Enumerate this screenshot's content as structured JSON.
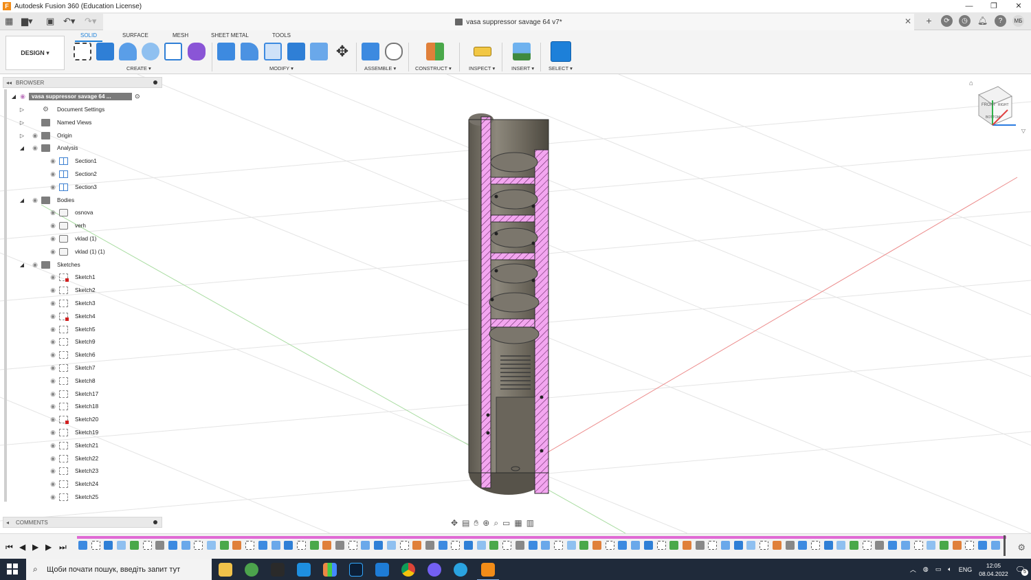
{
  "window": {
    "title": "Autodesk Fusion 360 (Education License)",
    "min": "—",
    "max": "❐",
    "close": "✕"
  },
  "document": {
    "tab_title": "vasa suppressor savage 64 v7*",
    "close": "✕"
  },
  "user": {
    "initials": "МБ"
  },
  "workspace": {
    "label": "DESIGN ▾"
  },
  "ribbon_tabs": [
    "SOLID",
    "SURFACE",
    "MESH",
    "SHEET METAL",
    "TOOLS"
  ],
  "ribbon_groups": {
    "create": "CREATE ▾",
    "modify": "MODIFY ▾",
    "assemble": "ASSEMBLE ▾",
    "construct": "CONSTRUCT ▾",
    "inspect": "INSPECT ▾",
    "insert": "INSERT ▾",
    "select": "SELECT ▾"
  },
  "browser": {
    "title": "BROWSER",
    "root": "vasa suppressor savage 64 ...",
    "items": [
      {
        "label": "Document Settings",
        "icon": "gear",
        "level": 1,
        "twisty": "▷",
        "eye": false
      },
      {
        "label": "Named Views",
        "icon": "folder",
        "level": 1,
        "twisty": "▷",
        "eye": false
      },
      {
        "label": "Origin",
        "icon": "folder",
        "level": 1,
        "twisty": "▷",
        "eye": true
      },
      {
        "label": "Analysis",
        "icon": "folder",
        "level": 1,
        "twisty": "◢",
        "eye": true
      },
      {
        "label": "Section1",
        "icon": "section",
        "level": 2,
        "eye": true
      },
      {
        "label": "Section2",
        "icon": "section",
        "level": 2,
        "eye": true
      },
      {
        "label": "Section3",
        "icon": "section",
        "level": 2,
        "eye": true
      },
      {
        "label": "Bodies",
        "icon": "folder",
        "level": 1,
        "twisty": "◢",
        "eye": true
      },
      {
        "label": "osnova",
        "icon": "body",
        "level": 2,
        "eye": true
      },
      {
        "label": "verh",
        "icon": "body",
        "level": 2,
        "eye": true
      },
      {
        "label": "vklad (1)",
        "icon": "body",
        "level": 2,
        "eye": true
      },
      {
        "label": "vklad (1) (1)",
        "icon": "body",
        "level": 2,
        "eye": true
      },
      {
        "label": "Sketches",
        "icon": "folder",
        "level": 1,
        "twisty": "◢",
        "eye": true
      },
      {
        "label": "Sketch1",
        "icon": "sketch-err",
        "level": 2,
        "eye": true
      },
      {
        "label": "Sketch2",
        "icon": "sketch",
        "level": 2,
        "eye": true
      },
      {
        "label": "Sketch3",
        "icon": "sketch",
        "level": 2,
        "eye": true
      },
      {
        "label": "Sketch4",
        "icon": "sketch-err",
        "level": 2,
        "eye": true
      },
      {
        "label": "Sketch5",
        "icon": "sketch",
        "level": 2,
        "eye": true
      },
      {
        "label": "Sketch9",
        "icon": "sketch",
        "level": 2,
        "eye": true
      },
      {
        "label": "Sketch6",
        "icon": "sketch",
        "level": 2,
        "eye": true
      },
      {
        "label": "Sketch7",
        "icon": "sketch",
        "level": 2,
        "eye": true
      },
      {
        "label": "Sketch8",
        "icon": "sketch",
        "level": 2,
        "eye": true
      },
      {
        "label": "Sketch17",
        "icon": "sketch",
        "level": 2,
        "eye": true
      },
      {
        "label": "Sketch18",
        "icon": "sketch",
        "level": 2,
        "eye": true
      },
      {
        "label": "Sketch20",
        "icon": "sketch-err",
        "level": 2,
        "eye": true
      },
      {
        "label": "Sketch19",
        "icon": "sketch",
        "level": 2,
        "eye": true
      },
      {
        "label": "Sketch21",
        "icon": "sketch",
        "level": 2,
        "eye": true
      },
      {
        "label": "Sketch22",
        "icon": "sketch",
        "level": 2,
        "eye": true
      },
      {
        "label": "Sketch23",
        "icon": "sketch",
        "level": 2,
        "eye": true
      },
      {
        "label": "Sketch24",
        "icon": "sketch",
        "level": 2,
        "eye": true
      },
      {
        "label": "Sketch25",
        "icon": "sketch",
        "level": 2,
        "eye": true
      }
    ]
  },
  "comments": {
    "title": "COMMENTS"
  },
  "viewcube": {
    "front": "FRONT",
    "right": "RIGHT",
    "bottom": "BOTTOM"
  },
  "taskbar": {
    "search_placeholder": "Щоби почати пошук, введіть запит тут",
    "lang": "ENG",
    "time": "12:05",
    "date": "08.04.2022",
    "notifications": "5"
  },
  "colors": {
    "accent": "#1d80d9",
    "section_hatch": "#f3a6f0",
    "model_metal": "#6e6a60",
    "timeline": "#e06ad4",
    "taskbar": "#1f2a3a"
  }
}
